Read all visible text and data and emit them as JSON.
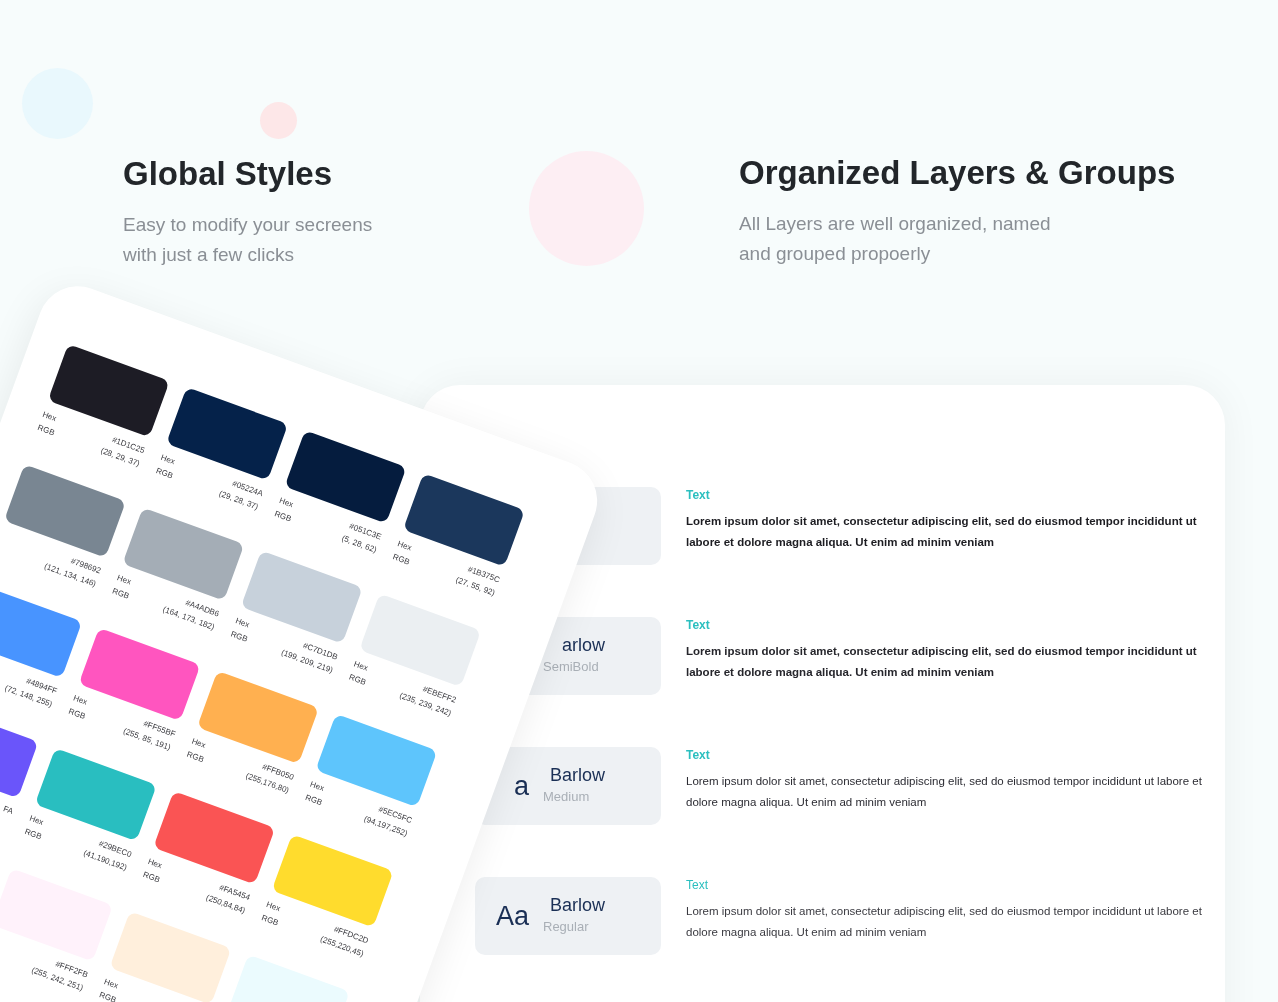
{
  "left_intro": {
    "title": "Global Styles",
    "subtitle_lines": [
      "Easy to modify your secreens",
      "with just a few clicks"
    ]
  },
  "right_intro": {
    "title": "Organized Layers & Groups",
    "subtitle_lines": [
      "All Layers are well organized, named",
      "and grouped propoerly"
    ]
  },
  "color_rows": [
    [
      {
        "color": "#1d1c25",
        "hex_label": "Hex",
        "rgb_label": "RGB",
        "hex": "#1D1C25",
        "rgb": "(28, 29, 37)"
      },
      {
        "color": "#05224a",
        "hex_label": "Hex",
        "rgb_label": "RGB",
        "hex": "#05224A",
        "rgb": "(29, 28, 37)"
      },
      {
        "color": "#051c3e",
        "hex_label": "Hex",
        "rgb_label": "RGB",
        "hex": "#051C3E",
        "rgb": "(5, 28, 62)"
      },
      {
        "color": "#1b375c",
        "hex_label": "Hex",
        "rgb_label": "RGB",
        "hex": "#1B375C",
        "rgb": "(27, 55, 92)"
      }
    ],
    [
      {
        "color": "#798692",
        "hex": "#798692",
        "rgb": "(121, 134, 146)"
      },
      {
        "color": "#a4adb6",
        "hex_label": "Hex",
        "rgb_label": "RGB",
        "hex": "#A4ADB6",
        "rgb": "(164, 173, 182)"
      },
      {
        "color": "#c7d1db",
        "hex_label": "Hex",
        "rgb_label": "RGB",
        "hex": "#C7D1DB",
        "rgb": "(199, 209, 219)"
      },
      {
        "color": "#ebeff2",
        "hex_label": "Hex",
        "rgb_label": "RGB",
        "hex": "#EBEFF2",
        "rgb": "(235, 239, 242)"
      }
    ],
    [
      {
        "color": "#4894ff",
        "hex": "#4894FF",
        "rgb": "(72, 148, 255)"
      },
      {
        "color": "#ff55bf",
        "hex_label": "Hex",
        "rgb_label": "RGB",
        "hex": "#FF55BF",
        "rgb": "(255, 85, 191)"
      },
      {
        "color": "#ffb050",
        "hex_label": "Hex",
        "rgb_label": "RGB",
        "hex": "#FFB050",
        "rgb": "(255,176,80)"
      },
      {
        "color": "#5ec5fc",
        "hex_label": "Hex",
        "rgb_label": "RGB",
        "hex": "#5EC5FC",
        "rgb": "(94,197,252)"
      }
    ],
    [
      {
        "color": "#6a55fa",
        "hex": "FA"
      },
      {
        "color": "#29bec0",
        "hex_label": "Hex",
        "rgb_label": "RGB",
        "hex": "#29BEC0",
        "rgb": "(41,190,192)"
      },
      {
        "color": "#fa5454",
        "hex_label": "Hex",
        "rgb_label": "RGB",
        "hex": "#FA5454",
        "rgb": "(250,84,84)"
      },
      {
        "color": "#ffdc2d",
        "hex_label": "Hex",
        "rgb_label": "RGB",
        "hex": "#FFDC2D",
        "rgb": "(255,220,45)"
      }
    ],
    [
      null,
      {
        "color": "#fff2fb",
        "hex": "#FFF2FB",
        "rgb": "(255, 242, 251)"
      },
      {
        "color": "#ffefdc",
        "hex_label": "Hex",
        "rgb_label": "RGB"
      },
      {
        "color": "#ebfbfe"
      }
    ]
  ],
  "type_styles": [
    {
      "label": "Text",
      "kind": "bold",
      "body": "Lorem ipsum dolor sit amet, consectetur adipiscing elit, sed do eiusmod tempor incididunt ut labore et dolore magna aliqua. Ut enim ad minim veniam"
    },
    {
      "name": "arlow",
      "style_name": "SemiBold",
      "label": "Text",
      "kind": "semibold",
      "body": "Lorem ipsum dolor sit amet, consectetur adipiscing elit, sed do eiusmod tempor incididunt ut labore et dolore magna aliqua. Ut enim ad minim veniam"
    },
    {
      "sample": "a",
      "name": "Barlow",
      "style_name": "Medium",
      "label": "Text",
      "kind": "medium",
      "body": "Lorem ipsum dolor sit amet, consectetur adipiscing elit, sed do eiusmod tempor incididunt ut labore et dolore magna aliqua. Ut enim ad minim veniam"
    },
    {
      "sample": "Aa",
      "name": "Barlow",
      "style_name": "Regular",
      "label": "Text",
      "kind": "regular",
      "body": "Lorem ipsum dolor sit amet, consectetur adipiscing elit, sed do eiusmod tempor incididunt ut labore et dolore magna aliqua. Ut enim ad minim veniam"
    }
  ]
}
